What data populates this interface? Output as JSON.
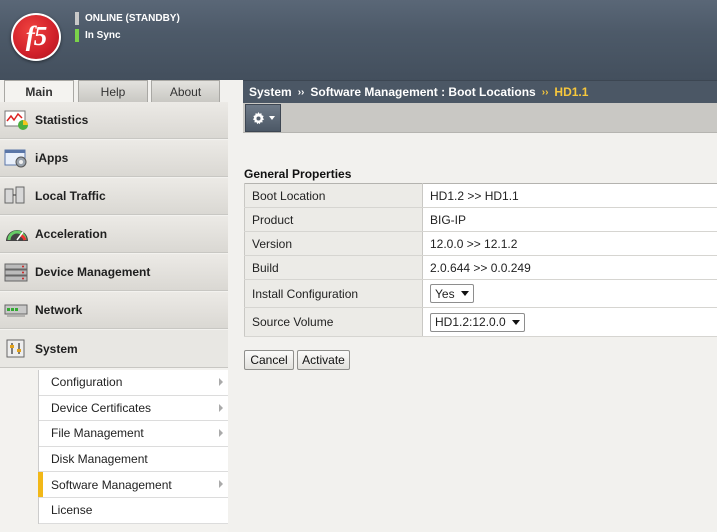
{
  "header": {
    "logo_text": "f5",
    "status_line_1": "ONLINE (STANDBY)",
    "status_line_2": "In Sync"
  },
  "tabs": [
    {
      "label": "Main",
      "selected": true
    },
    {
      "label": "Help",
      "selected": false
    },
    {
      "label": "About",
      "selected": false
    }
  ],
  "sidebar": {
    "items": [
      {
        "label": "Statistics",
        "icon": "statistics-icon"
      },
      {
        "label": "iApps",
        "icon": "iapps-icon"
      },
      {
        "label": "Local Traffic",
        "icon": "local-traffic-icon"
      },
      {
        "label": "Acceleration",
        "icon": "acceleration-icon"
      },
      {
        "label": "Device Management",
        "icon": "device-management-icon"
      },
      {
        "label": "Network",
        "icon": "network-icon"
      },
      {
        "label": "System",
        "icon": "system-icon"
      }
    ],
    "submenu": [
      {
        "label": "Configuration",
        "has_arrow": true
      },
      {
        "label": "Device Certificates",
        "has_arrow": true
      },
      {
        "label": "File Management",
        "has_arrow": true
      },
      {
        "label": "Disk Management",
        "has_arrow": false
      },
      {
        "label": "Software Management",
        "has_arrow": true,
        "selected": true
      },
      {
        "label": "License",
        "has_arrow": false
      }
    ]
  },
  "breadcrumb": {
    "part1": "System",
    "separator": "››",
    "part2": "Software Management : Boot Locations",
    "current": "HD1.1"
  },
  "toolbar": {
    "gear_icon": "gear-icon"
  },
  "general_properties": {
    "title": "General Properties",
    "rows": [
      {
        "label": "Boot Location",
        "value": "HD1.2 >> HD1.1"
      },
      {
        "label": "Product",
        "value": "BIG-IP"
      },
      {
        "label": "Version",
        "value": "12.0.0 >> 12.1.2"
      },
      {
        "label": "Build",
        "value": "2.0.644 >> 0.0.249"
      },
      {
        "label": "Install Configuration",
        "select": "Yes"
      },
      {
        "label": "Source Volume",
        "select": "HD1.2:12.0.0"
      }
    ]
  },
  "buttons": {
    "cancel": "Cancel",
    "activate": "Activate"
  },
  "colors": {
    "header_bg": "#4d5a69",
    "breadcrumb_current": "#f7c73c",
    "selected_marker": "#f2b818",
    "sync_indicator": "#7bd34a"
  }
}
